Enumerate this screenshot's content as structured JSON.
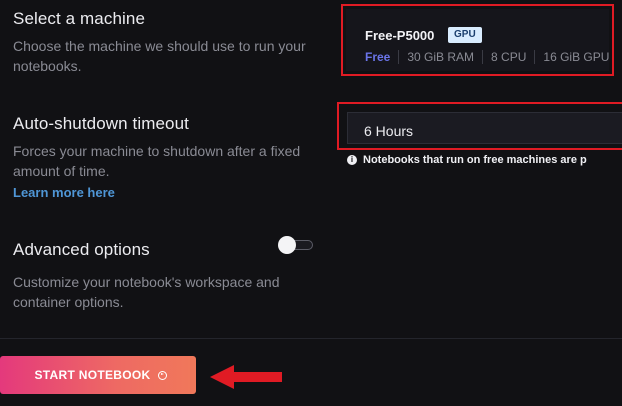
{
  "machine": {
    "title": "Select a machine",
    "desc_line1": "Choose the machine we should use to run your",
    "desc_line2": "notebooks.",
    "card": {
      "name": "Free-P5000",
      "badge": "GPU",
      "tier": "Free",
      "ram": "30 GiB RAM",
      "cpu": "8 CPU",
      "gpu": "16 GiB GPU"
    }
  },
  "shutdown": {
    "title": "Auto-shutdown timeout",
    "desc_line1": "Forces your machine to shutdown after a fixed",
    "desc_line2": "amount of time.",
    "link": "Learn more here",
    "selected_value": "6 Hours",
    "notice": "Notebooks that run on free machines are p"
  },
  "advanced": {
    "title": "Advanced options",
    "desc_line1": "Customize your notebook's workspace and",
    "desc_line2": "container options.",
    "toggle_on": false
  },
  "footer": {
    "start_label": "START NOTEBOOK"
  },
  "colors": {
    "background": "#111114",
    "highlight_border": "#e01b24",
    "link": "#4f96d6",
    "free_tier": "#6a74e8",
    "button_gradient_start": "#e4397c",
    "button_gradient_end": "#f0785a",
    "annotation_arrow": "#e01b24"
  },
  "icons": {
    "info": "info-icon",
    "play": "play-circle-icon",
    "annotation": "left-arrow-icon"
  }
}
